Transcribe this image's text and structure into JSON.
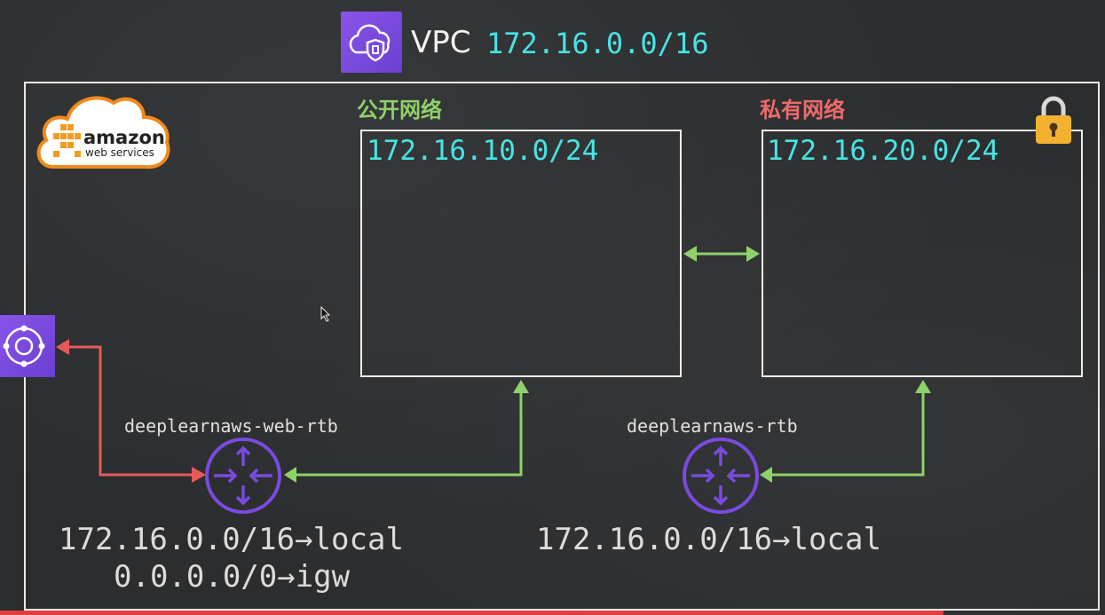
{
  "header": {
    "title": "VPC",
    "cidr": "172.16.0.0/16",
    "icon": "vpc-shield-icon"
  },
  "logo": {
    "brand": "amazon",
    "sub": "web services"
  },
  "public_subnet": {
    "label": "公开网络",
    "cidr": "172.16.10.0/24"
  },
  "private_subnet": {
    "label": "私有网络",
    "cidr": "172.16.20.0/24",
    "icon": "lock-icon"
  },
  "gateway": {
    "icon": "internet-gateway-icon"
  },
  "web_route_table": {
    "name": "deeplearnaws-web-rtb",
    "routes": [
      "172.16.0.0/16→local",
      "0.0.0.0/0→igw"
    ]
  },
  "private_route_table": {
    "name": "deeplearnaws-rtb",
    "routes": [
      "172.16.0.0/16→local"
    ]
  },
  "colors": {
    "cidr": "#49e3e3",
    "public": "#8fd16a",
    "private": "#ef6a6a",
    "service": "#7a4ae0",
    "igw_link": "#e85a5a",
    "subnet_link": "#8fd16a"
  }
}
